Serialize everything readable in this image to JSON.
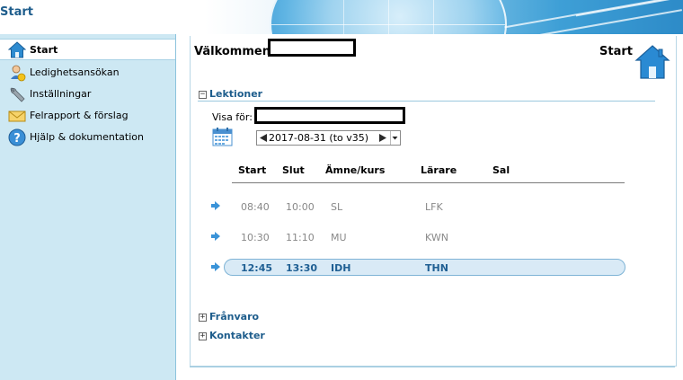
{
  "header": {
    "title": "Start"
  },
  "sidebar": {
    "items": [
      {
        "label": "Start",
        "icon": "home-icon",
        "active": true
      },
      {
        "label": "Ledighetsansökan",
        "icon": "user-icon"
      },
      {
        "label": "Inställningar",
        "icon": "wrench-icon"
      },
      {
        "label": "Felrapport & förslag",
        "icon": "envelope-icon"
      },
      {
        "label": "Hjälp & dokumentation",
        "icon": "help-icon"
      }
    ]
  },
  "main": {
    "welcome": "Välkommen",
    "page_heading": "Start",
    "sections": {
      "lektioner": {
        "toggle": "−",
        "title": "Lektioner"
      },
      "franvaro": {
        "toggle": "+",
        "title": "Frånvaro"
      },
      "kontakter": {
        "toggle": "+",
        "title": "Kontakter"
      }
    },
    "visa_for_label": "Visa för:",
    "week_select": {
      "value": "2017-08-31 (to v35)"
    },
    "table": {
      "headers": [
        "Start",
        "Slut",
        "Ämne/kurs",
        "Lärare",
        "Sal"
      ],
      "rows": [
        {
          "start": "08:40",
          "slut": "10:00",
          "amne": "SL",
          "larare": "LFK",
          "sal": ""
        },
        {
          "start": "10:30",
          "slut": "11:10",
          "amne": "MU",
          "larare": "KWN",
          "sal": ""
        },
        {
          "start": "12:45",
          "slut": "13:30",
          "amne": "IDH",
          "larare": "THN",
          "sal": "",
          "current": true
        }
      ]
    }
  },
  "colors": {
    "accent": "#1e5d8c",
    "sidebar_bg": "#cde8f3",
    "row_highlight": "#d9eaf6"
  }
}
